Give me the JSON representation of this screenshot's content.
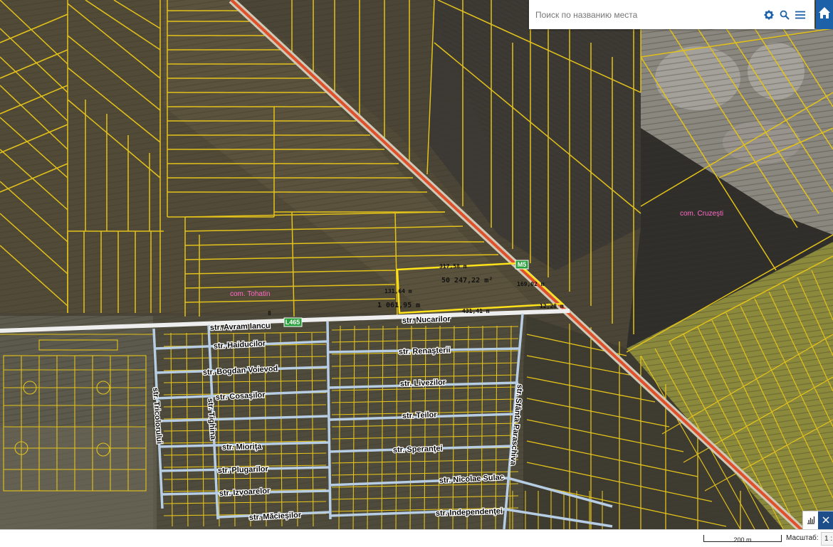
{
  "search": {
    "placeholder": "Поиск по названию места"
  },
  "icons": {
    "settings": "gear-icon",
    "search": "search-icon",
    "menu": "menu-icon",
    "home": "home-icon",
    "chart": "chart-icon",
    "close": "close-icon"
  },
  "colors": {
    "parcel": "#e3c21a",
    "street": "#b7cde4",
    "highway": "#e0502a",
    "road_badge": "#28a03c",
    "selection": "#ffe21a",
    "commune": "#ff6ac8"
  },
  "map": {
    "roads": [
      {
        "id": "M5"
      },
      {
        "id": "L465"
      }
    ],
    "communes": [
      "com. Tohatin",
      "com. Cruzeşti"
    ],
    "measurements": {
      "top": "317,58 m",
      "area": "50 247,22 m²",
      "right": "169,02 m",
      "left": "131,64 m",
      "perimeter": "1 061,95 m",
      "bottom": "431,41 m",
      "corner": "12,28 m"
    },
    "marker": "8",
    "streets": [
      "str. Avram Iancu",
      "str. Nucarilor",
      "str. Haiducilor",
      "str. Renaşterii",
      "str. Bogdan Voievod",
      "str. Livezilor",
      "str. Cosaşilor",
      "str. Teilor",
      "str. Tricolorului",
      "str. Tighina",
      "str. Mioriţa",
      "str. Speranţei",
      "str. Sfânta Paraschiva",
      "str. Plugarilor",
      "str. Nicolae Sulac",
      "str. Izvoarelor",
      "str. Independenţei",
      "str. Măcieşilor"
    ]
  },
  "footer": {
    "scale_distance": "200 m",
    "scale_label": "Масштаб:",
    "scale_ratio": "1 :"
  }
}
